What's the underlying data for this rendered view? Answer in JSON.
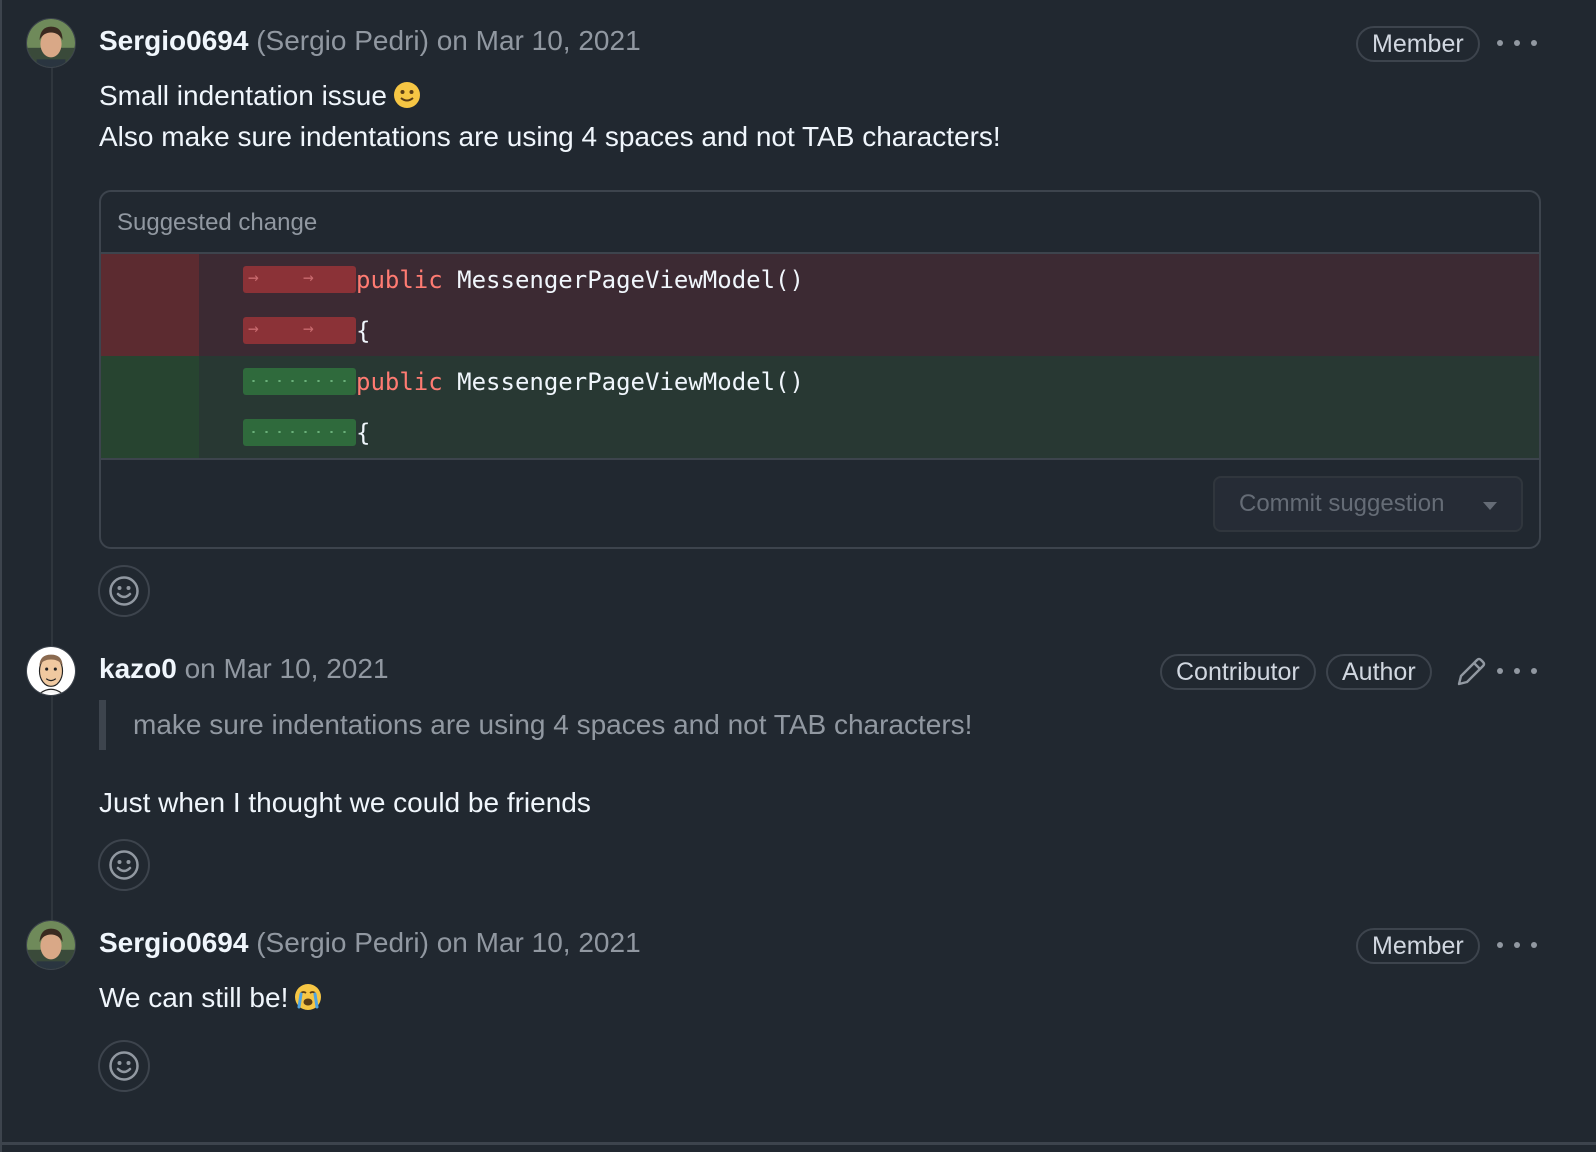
{
  "comments": [
    {
      "username": "Sergio0694",
      "fullname": "(Sergio Pedri)",
      "date": "on Mar 10, 2021",
      "badges": [
        "Member"
      ],
      "body": [
        "Small indentation issue",
        "Also make sure indentations are using 4 spaces and not TAB characters!"
      ],
      "emoji": "slightly-smiling-face",
      "suggestion": {
        "title": "Suggested change",
        "removed_lines": [
          "MessengerPageViewModel()",
          "{"
        ],
        "added_lines": [
          "MessengerPageViewModel()",
          "{"
        ],
        "keyword": "public",
        "commit_label": "Commit suggestion"
      }
    },
    {
      "username": "kazo0",
      "date": "on Mar 10, 2021",
      "badges": [
        "Contributor",
        "Author"
      ],
      "quote": "make sure indentations are using 4 spaces and not TAB characters!",
      "body": [
        "Just when I thought we could be friends"
      ]
    },
    {
      "username": "Sergio0694",
      "fullname": "(Sergio Pedri)",
      "date": "on Mar 10, 2021",
      "badges": [
        "Member"
      ],
      "body": [
        "We can still be!"
      ],
      "emoji": "loudly-crying-face"
    }
  ],
  "colors": {
    "background": "#212830",
    "deleted_line": "#3c2a33",
    "added_line": "#283833",
    "keyword": "#ff7b72"
  },
  "icons": [
    "smiley-icon",
    "pencil-icon",
    "kebab-horizontal-icon",
    "triangle-down-icon",
    "tab-arrow-icon"
  ]
}
